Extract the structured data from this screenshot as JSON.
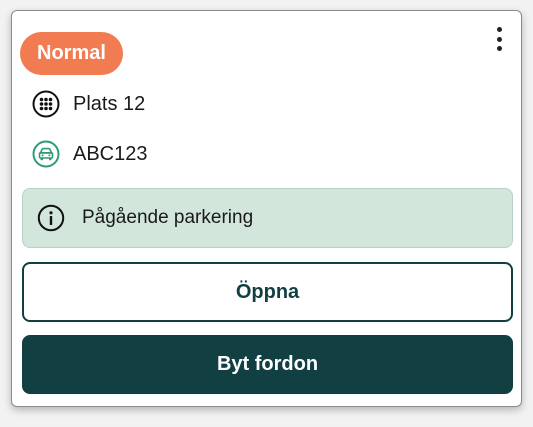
{
  "colors": {
    "badge_bg": "#f27c52",
    "info_bg": "#d2e6dc",
    "info_border": "#b7d2c4",
    "primary": "#123f42",
    "vehicle_icon": "#2e9a78"
  },
  "card": {
    "status_badge": "Normal",
    "menu_icon": "more-vertical-icon",
    "location": {
      "icon": "grid-icon",
      "label": "Plats 12"
    },
    "vehicle": {
      "icon": "car-icon",
      "plate": "ABC123"
    },
    "info": {
      "icon": "info-icon",
      "text": "Pågående parkering"
    },
    "open_button": "Öppna",
    "change_vehicle_button": "Byt fordon"
  }
}
